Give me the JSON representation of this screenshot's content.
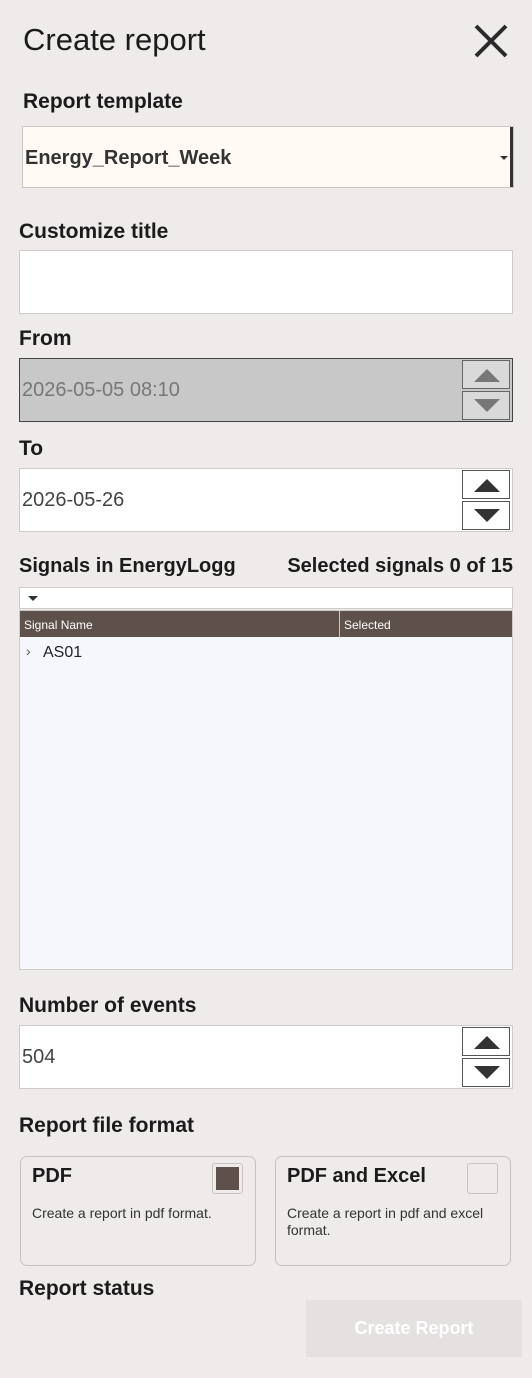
{
  "header": {
    "title": "Create report"
  },
  "template": {
    "label": "Report template",
    "value": "Energy_Report_Week"
  },
  "custom_title": {
    "label": "Customize title",
    "value": ""
  },
  "from": {
    "label": "From",
    "value": "2026-05-05 08:10",
    "disabled": true
  },
  "to": {
    "label": "To",
    "value": "2026-05-26"
  },
  "signals": {
    "label": "Signals in EnergyLogg",
    "selected_text": "Selected signals 0 of 15",
    "columns": [
      "Signal Name",
      "Selected"
    ],
    "rows": [
      {
        "name": "AS01",
        "expand": "›"
      }
    ]
  },
  "events": {
    "label": "Number of events",
    "value": "504"
  },
  "format": {
    "label": "Report file format",
    "options": [
      {
        "title": "PDF",
        "desc": "Create a report in pdf format.",
        "checked": true
      },
      {
        "title": "PDF and Excel",
        "desc": "Create a report in pdf and excel format.",
        "checked": false
      }
    ]
  },
  "status": {
    "label": "Report status"
  },
  "actions": {
    "create_label": "Create Report"
  },
  "colors": {
    "accent": "#5e504b",
    "background": "#efebea",
    "field_highlight": "#fffaf3"
  }
}
